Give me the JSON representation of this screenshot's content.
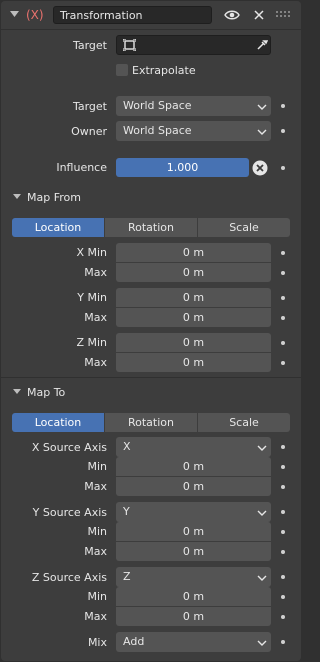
{
  "header": {
    "constraint_icon": "(X)",
    "name_value": "Transformation"
  },
  "target": {
    "label": "Target"
  },
  "extrapolate": {
    "label": "Extrapolate",
    "checked": false
  },
  "space": {
    "target_label": "Target",
    "target_value": "World Space",
    "owner_label": "Owner",
    "owner_value": "World Space"
  },
  "influence": {
    "label": "Influence",
    "value": "1.000"
  },
  "map_from": {
    "title": "Map From",
    "tabs": [
      "Location",
      "Rotation",
      "Scale"
    ],
    "active_tab": "Location",
    "x_min_label": "X Min",
    "x_min": "0 m",
    "x_max_label": "Max",
    "x_max": "0 m",
    "y_min_label": "Y Min",
    "y_min": "0 m",
    "y_max_label": "Max",
    "y_max": "0 m",
    "z_min_label": "Z Min",
    "z_min": "0 m",
    "z_max_label": "Max",
    "z_max": "0 m"
  },
  "map_to": {
    "title": "Map To",
    "tabs": [
      "Location",
      "Rotation",
      "Scale"
    ],
    "active_tab": "Location",
    "x_axis_label": "X Source Axis",
    "x_axis_value": "X",
    "x_min_label": "Min",
    "x_min": "0 m",
    "x_max_label": "Max",
    "x_max": "0 m",
    "y_axis_label": "Y Source Axis",
    "y_axis_value": "Y",
    "y_min_label": "Min",
    "y_min": "0 m",
    "y_max_label": "Max",
    "y_max": "0 m",
    "z_axis_label": "Z Source Axis",
    "z_axis_value": "Z",
    "z_min_label": "Min",
    "z_min": "0 m",
    "z_max_label": "Max",
    "z_max": "0 m",
    "mix_label": "Mix",
    "mix_value": "Add"
  },
  "colors": {
    "panel": "#3d3d3d",
    "field": "#545454",
    "accent": "#4772b3",
    "constraint_icon": "#e8716d"
  }
}
